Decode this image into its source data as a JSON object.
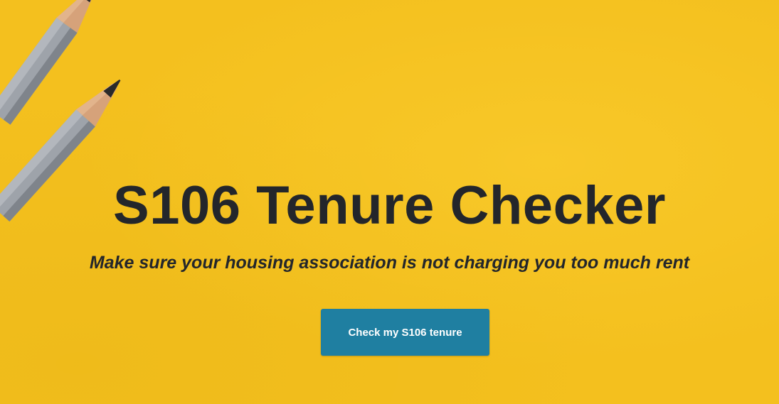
{
  "hero": {
    "title": "S106 Tenure Checker",
    "subtitle": "Make sure your housing association is not charging you too much rent",
    "cta_label": "Check my S106 tenure",
    "background_color": "#f4c01e",
    "text_color": "#23262b",
    "cta_color": "#1f7fa1",
    "decoration": "pencils-image"
  }
}
